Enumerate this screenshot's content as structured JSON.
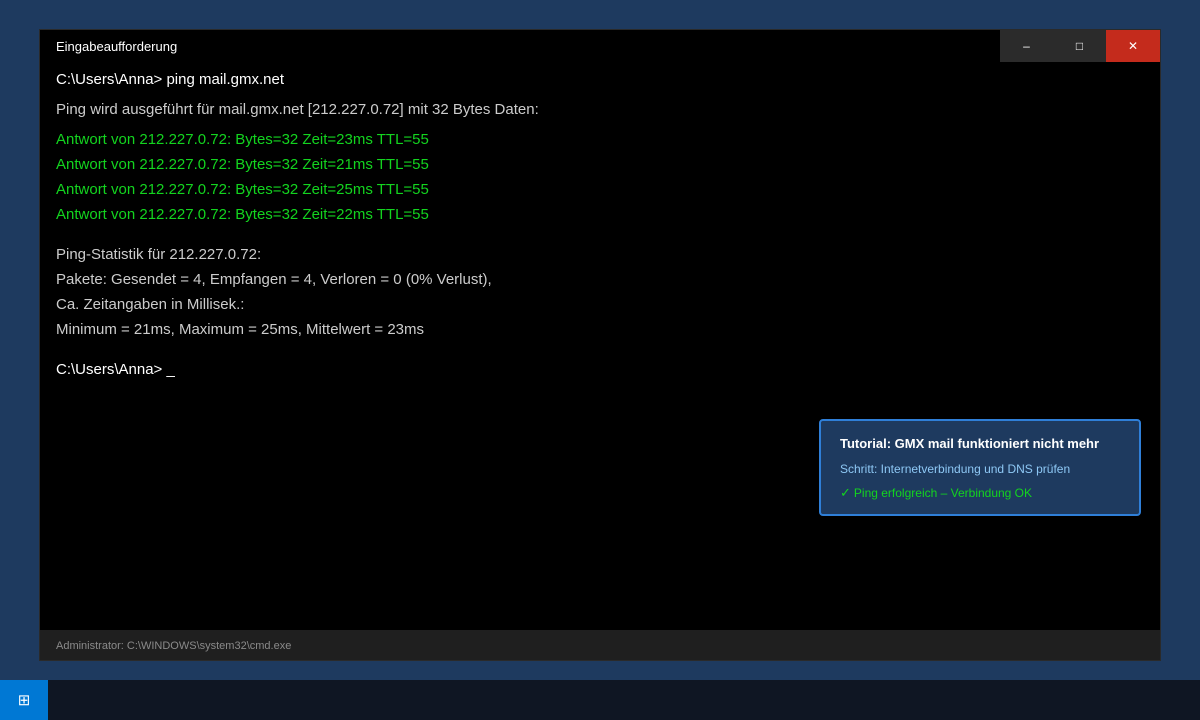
{
  "window": {
    "title": "Eingabeaufforderung",
    "minimize_glyph": "–",
    "maximize_glyph": "□",
    "close_glyph": "✕"
  },
  "console": {
    "command_prompt": "C:\\Users\\Anna> ping mail.gmx.net",
    "ping_header": "Ping wird ausgeführt für mail.gmx.net [212.227.0.72] mit 32 Bytes Daten:",
    "replies": [
      "Antwort von 212.227.0.72: Bytes=32 Zeit=23ms TTL=55",
      "Antwort von 212.227.0.72: Bytes=32 Zeit=21ms TTL=55",
      "Antwort von 212.227.0.72: Bytes=32 Zeit=25ms TTL=55",
      "Antwort von 212.227.0.72: Bytes=32 Zeit=22ms TTL=55"
    ],
    "stats_title": "Ping-Statistik für 212.227.0.72:",
    "stats_packets": "Pakete: Gesendet = 4, Empfangen = 4, Verloren = 0 (0% Verlust),",
    "stats_time_header": "Ca. Zeitangaben in Millisek.:",
    "stats_times": "Minimum = 21ms, Maximum = 25ms, Mittelwert = 23ms",
    "current_prompt": "C:\\Users\\Anna> _"
  },
  "tutorial": {
    "title": "Tutorial: GMX mail funktioniert nicht mehr",
    "step": "Schritt: Internetverbindung und DNS prüfen",
    "check_glyph": "✓",
    "status": "Ping erfolgreich – Verbindung OK"
  },
  "statusbar": {
    "text": "Administrator: C:\\WINDOWS\\system32\\cmd.exe"
  },
  "taskbar": {
    "start_glyph": "⊞",
    "start_icon": "windows-start-icon"
  },
  "colors": {
    "desktop": "#1e3a5f",
    "console_bg": "#000000",
    "reply_green": "#13d41f",
    "close_red": "#c42b1c",
    "accent_blue": "#0078d4"
  }
}
